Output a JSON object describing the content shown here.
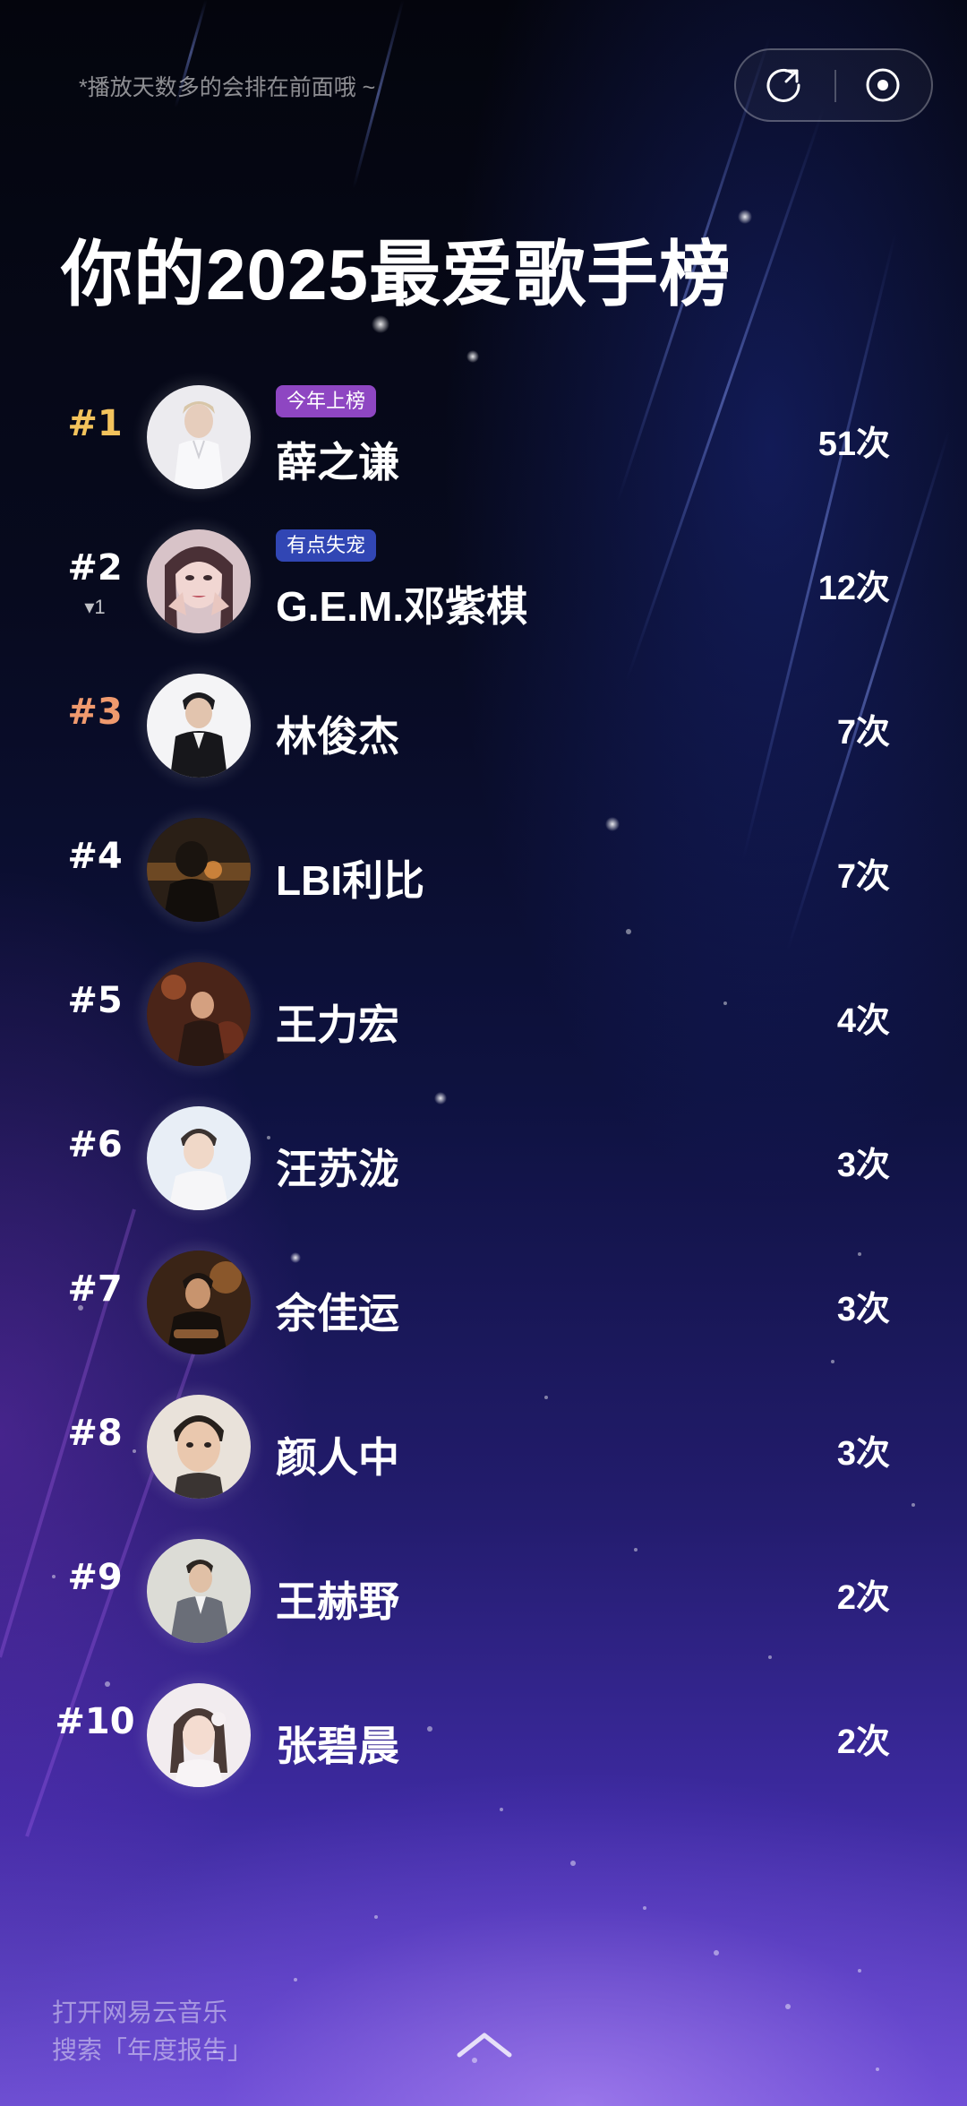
{
  "header": {
    "hint": "*播放天数多的会排在前面哦 ~",
    "title": "你的2025最爱歌手榜",
    "share_icon": "share-icon",
    "record_icon": "record-icon"
  },
  "colors": {
    "rank_gold": "#f3c35c",
    "rank_orange": "#f09a6e",
    "tag_purple": "#8e46c2",
    "tag_blue": "#3146b4"
  },
  "artists": [
    {
      "rank": "#1",
      "name": "薛之谦",
      "count": "51次",
      "tag": "今年上榜",
      "rank_change": ""
    },
    {
      "rank": "#2",
      "name": "G.E.M.邓紫棋",
      "count": "12次",
      "tag": "有点失宠",
      "rank_change": "▾1"
    },
    {
      "rank": "#3",
      "name": "林俊杰",
      "count": "7次",
      "tag": "",
      "rank_change": ""
    },
    {
      "rank": "#4",
      "name": "LBI利比",
      "count": "7次",
      "tag": "",
      "rank_change": ""
    },
    {
      "rank": "#5",
      "name": "王力宏",
      "count": "4次",
      "tag": "",
      "rank_change": ""
    },
    {
      "rank": "#6",
      "name": "汪苏泷",
      "count": "3次",
      "tag": "",
      "rank_change": ""
    },
    {
      "rank": "#7",
      "name": "余佳运",
      "count": "3次",
      "tag": "",
      "rank_change": ""
    },
    {
      "rank": "#8",
      "name": "颜人中",
      "count": "3次",
      "tag": "",
      "rank_change": ""
    },
    {
      "rank": "#9",
      "name": "王赫野",
      "count": "2次",
      "tag": "",
      "rank_change": ""
    },
    {
      "rank": "#10",
      "name": "张碧晨",
      "count": "2次",
      "tag": "",
      "rank_change": ""
    }
  ],
  "footer": {
    "line1": "打开网易云音乐",
    "line2": "搜索「年度报告」",
    "up_icon": "chevron-up-icon"
  }
}
